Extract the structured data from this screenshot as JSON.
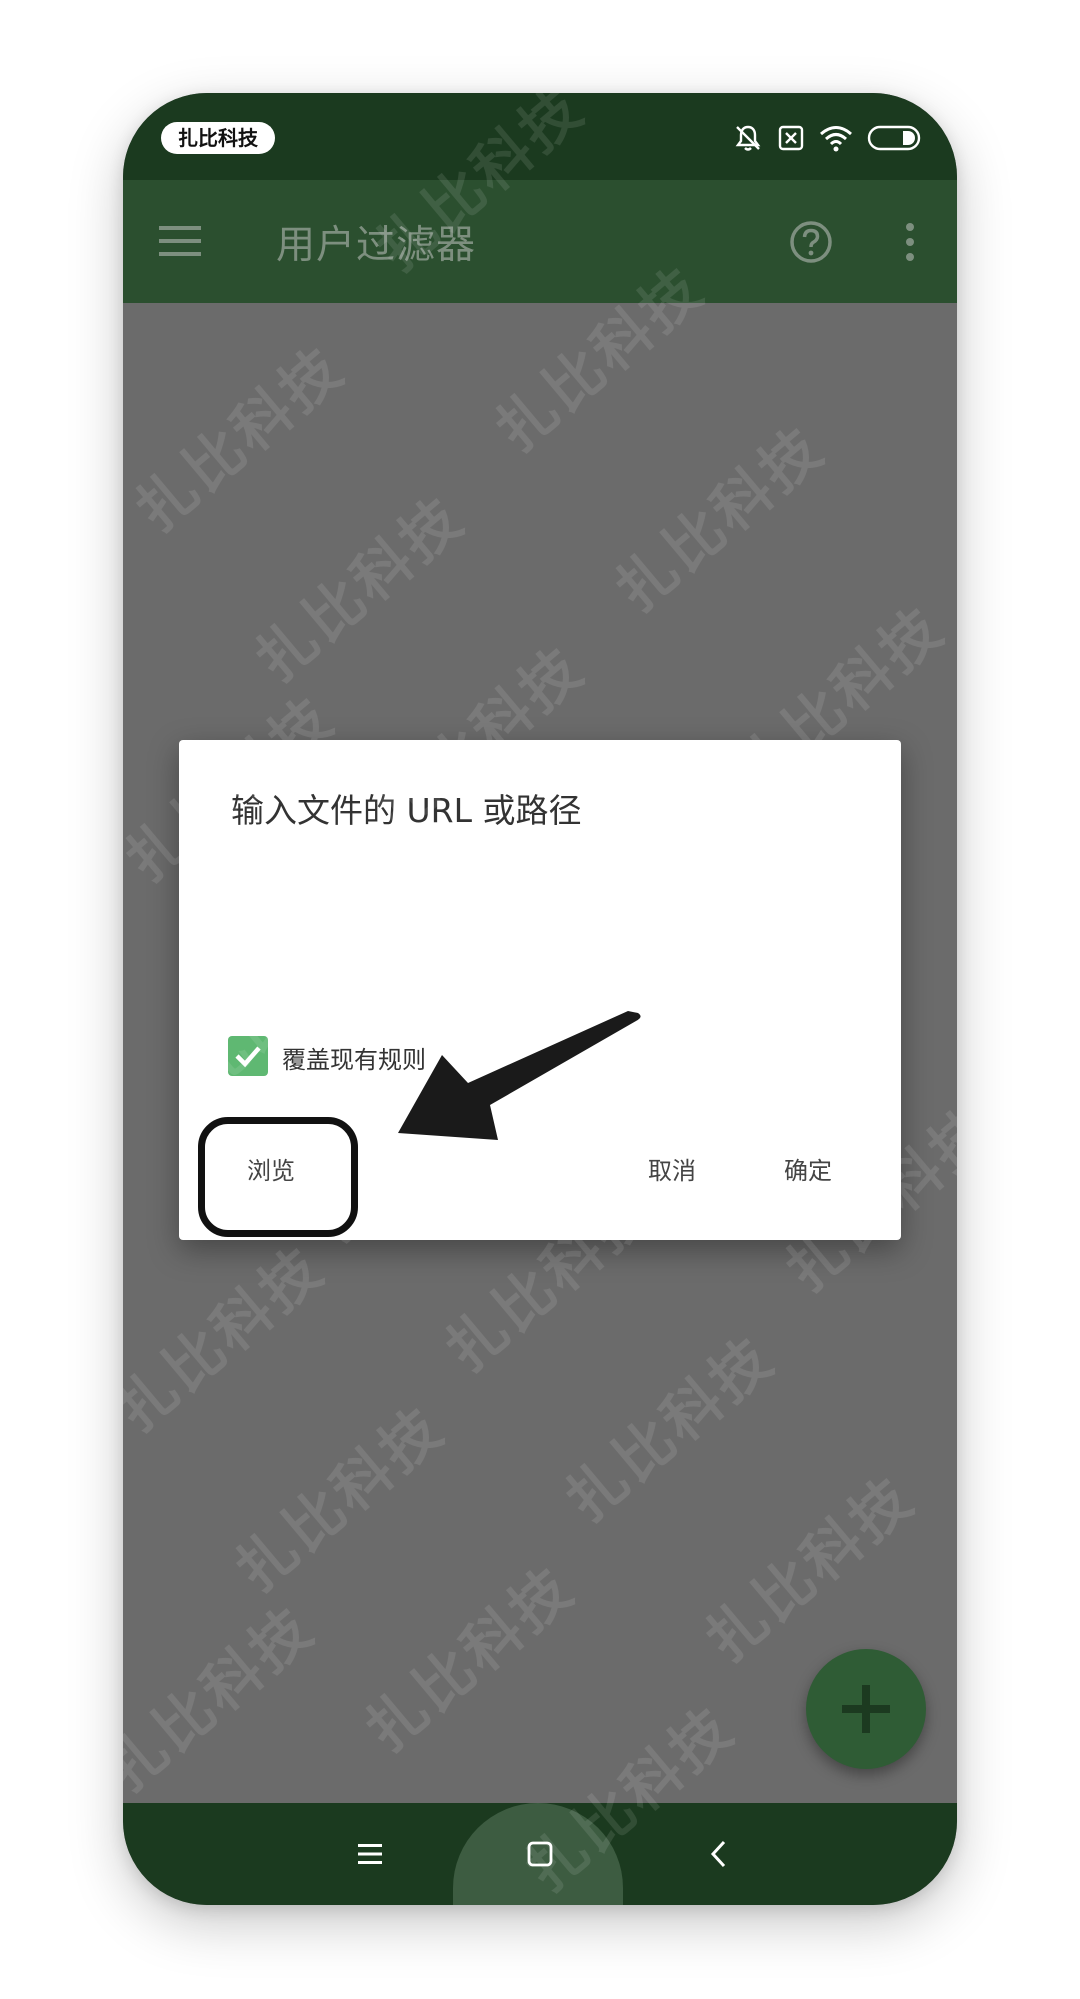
{
  "status_bar": {
    "brand_badge": "扎比科技",
    "icons": [
      "bell-off-icon",
      "sim-x-icon",
      "wifi-icon",
      "battery-icon"
    ]
  },
  "app_bar": {
    "title": "用户过滤器",
    "icons": [
      "menu-icon",
      "help-icon",
      "overflow-icon"
    ]
  },
  "dialog": {
    "title": "输入文件的 URL 或路径",
    "checkbox": {
      "label": "覆盖现有规则",
      "checked": true
    },
    "buttons": {
      "browse": "浏览",
      "cancel": "取消",
      "ok": "确定"
    }
  },
  "fab": {
    "icon": "plus-icon"
  },
  "nav_bar": {
    "icons": [
      "recents-icon",
      "home-icon",
      "back-icon"
    ]
  },
  "watermark": "扎比科技",
  "colors": {
    "status_bar": "#1b3a1f",
    "app_bar_dimmed": "#2b4f2f",
    "scrim": "#6b6b6b",
    "checkbox": "#5fb872",
    "fab": "#2f5c35"
  }
}
